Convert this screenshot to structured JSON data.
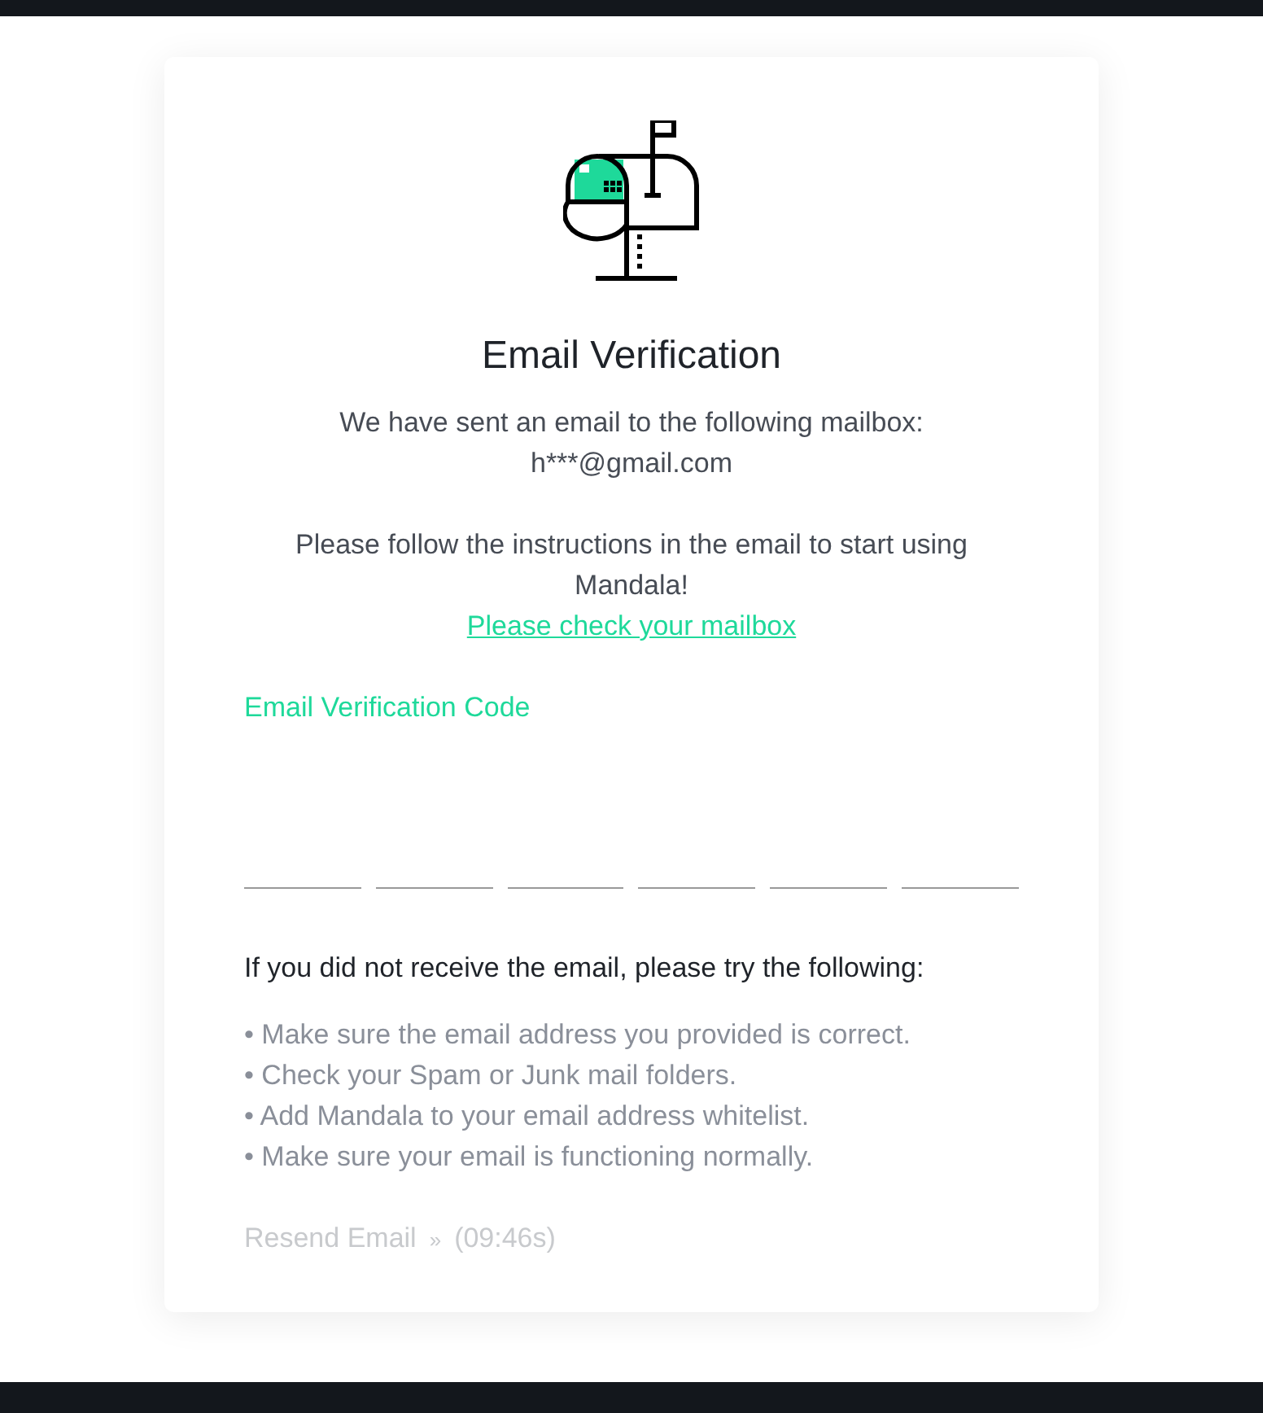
{
  "title": "Email Verification",
  "sent_message": "We have sent an email to the following mailbox:",
  "email": "h***@gmail.com",
  "instructions": "Please follow the instructions in the email to start using Mandala!",
  "check_link": "Please check your mailbox",
  "code_label": "Email Verification Code",
  "code_digits": [
    {
      "filled": false
    },
    {
      "filled": false
    },
    {
      "filled": false
    },
    {
      "filled": false
    },
    {
      "filled": false
    },
    {
      "filled": false
    }
  ],
  "help_heading": "If you did not receive the email, please try the following:",
  "help_items": [
    "• Make sure the email address you provided is correct.",
    "• Check your Spam or Junk mail folders.",
    "• Add Mandala to your email address whitelist.",
    "• Make sure your email is functioning normally."
  ],
  "resend": {
    "label": "Resend Email",
    "arrow": "»",
    "countdown": "(09:46s)",
    "disabled": true
  }
}
